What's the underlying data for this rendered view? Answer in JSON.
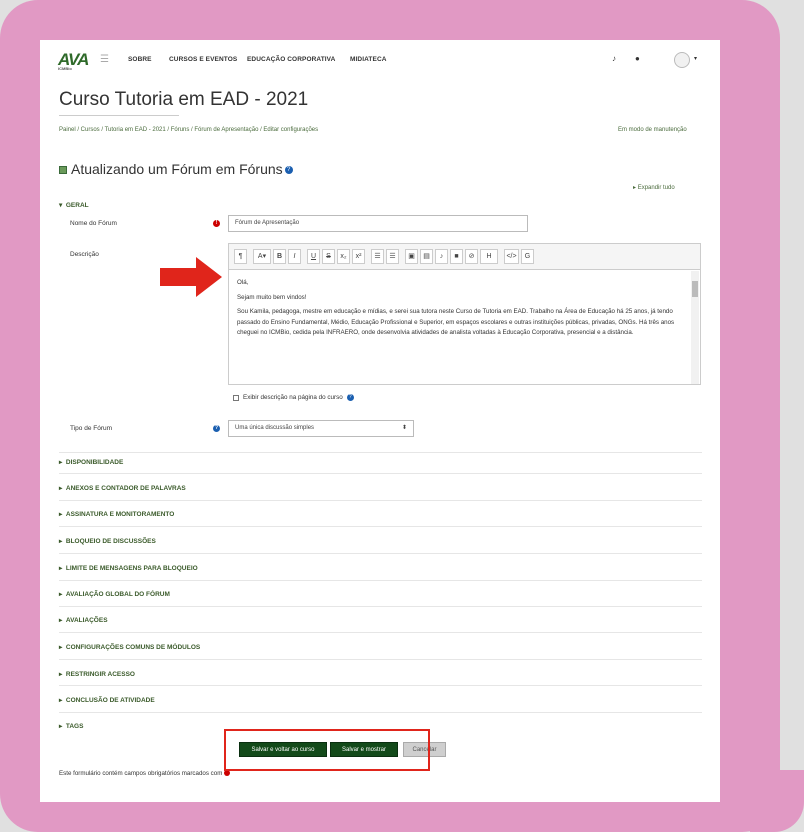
{
  "nav": {
    "logo": "AVA",
    "logo_sub": "ICMBio",
    "items": [
      "SOBRE",
      "CURSOS E EVENTOS",
      "EDUCAÇÃO CORPORATIVA",
      "MIDIATECA"
    ]
  },
  "page": {
    "title": "Curso Tutoria em EAD - 2021",
    "breadcrumb": "Painel / Cursos / Tutoria em EAD - 2021 / Fóruns / Fórum de Apresentação / Editar configurações",
    "maintenance": "Em modo de manutenção",
    "heading": "Atualizando um Fórum em Fóruns",
    "expand_all": "Expandir tudo"
  },
  "geral": {
    "section_label": "GERAL",
    "name_label": "Nome do Fórum",
    "name_value": "Fórum de Apresentação",
    "desc_label": "Descrição",
    "editor_buttons": [
      "¶",
      "A▾",
      "B",
      "I",
      "U",
      "S",
      "x₂",
      "x²",
      "☰",
      "☰",
      "▣",
      "▤",
      "♪",
      "■",
      "⊘",
      "H",
      "</>",
      "G"
    ],
    "desc_p1": "Olá,",
    "desc_p2": "Sejam muito bem vindos!",
    "desc_p3": "Sou Kamila, pedagoga, mestre em educação e mídias, e serei sua tutora neste Curso de Tutoria em EAD. Trabalho na Área de Educação há 25 anos, já tendo passado do Ensino Fundamental, Médio, Educação Profissional e Superior, em espaços escolares e outras instituições públicas, privadas, ONGs. Há três anos cheguei no ICMBio, cedida pela INFRAERO, onde desenvolvia atividades de analista voltadas à Educação Corporativa, presencial e a distância.",
    "show_desc": "Exibir descrição na página do curso",
    "type_label": "Tipo de Fórum",
    "type_value": "Uma única discussão simples"
  },
  "sections": [
    "DISPONIBILIDADE",
    "ANEXOS E CONTADOR DE PALAVRAS",
    "ASSINATURA E MONITORAMENTO",
    "BLOQUEIO DE DISCUSSÕES",
    "LIMITE DE MENSAGENS PARA BLOQUEIO",
    "AVALIAÇÃO GLOBAL DO FÓRUM",
    "AVALIAÇÕES",
    "CONFIGURAÇÕES COMUNS DE MÓDULOS",
    "RESTRINGIR ACESSO",
    "CONCLUSÃO DE ATIVIDADE",
    "TAGS"
  ],
  "actions": {
    "save_return": "Salvar e voltar ao curso",
    "save_show": "Salvar e mostrar",
    "cancel": "Cancelar"
  },
  "footer": "Este formulário contém campos obrigatórios marcados com",
  "colors": {
    "frame": "#e199c4",
    "primary_button": "#134a1a",
    "highlight": "#e0251b"
  }
}
